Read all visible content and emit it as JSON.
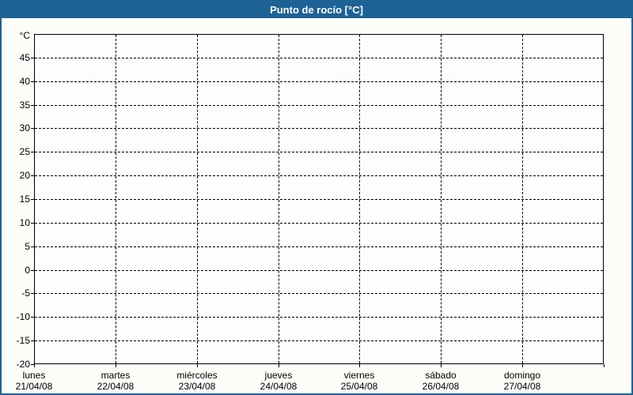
{
  "window": {
    "title": "Punto de rocío [°C]"
  },
  "colors": {
    "titlebar_bg": "#1d6295",
    "titlebar_text": "#ffffff",
    "window_border": "#1d6295",
    "background": "#fcfdf8",
    "plot_background": "#fdfefb",
    "grid": "#000000",
    "axis": "#000000",
    "text": "#000000"
  },
  "chart_data": {
    "type": "line",
    "title": "Punto de rocío [°C]",
    "y_unit_label": "°C",
    "xlabel": "",
    "ylabel": "",
    "ylim": [
      -20,
      50
    ],
    "y_tick_step": 5,
    "y_ticks": [
      45,
      40,
      35,
      30,
      25,
      20,
      15,
      10,
      5,
      0,
      -5,
      -10,
      -15,
      -20
    ],
    "x_categories": [
      {
        "day": "lunes",
        "date": "21/04/08"
      },
      {
        "day": "martes",
        "date": "22/04/08"
      },
      {
        "day": "miércoles",
        "date": "23/04/08"
      },
      {
        "day": "jueves",
        "date": "24/04/08"
      },
      {
        "day": "viernes",
        "date": "25/04/08"
      },
      {
        "day": "sábado",
        "date": "26/04/08"
      },
      {
        "day": "domingo",
        "date": "27/04/08"
      }
    ],
    "series": [],
    "grid": "dashed",
    "legend_position": "none"
  }
}
